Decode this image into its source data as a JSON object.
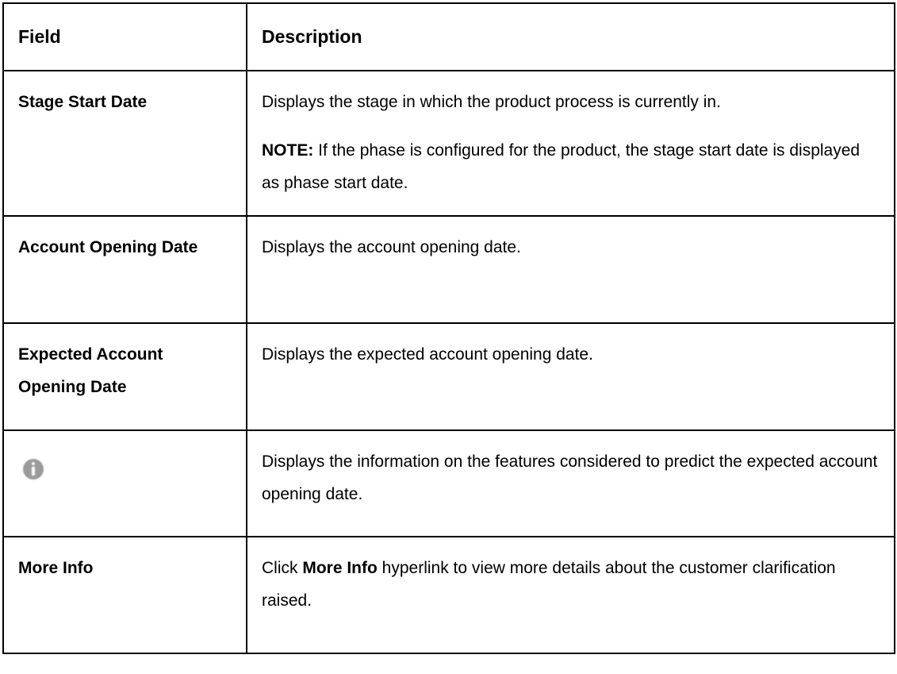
{
  "table": {
    "headers": {
      "field": "Field",
      "description": "Description"
    },
    "rows": [
      {
        "field": "Stage Start Date",
        "description": "Displays the stage in which the product process is currently in.",
        "note_label": "NOTE:",
        "note_text": " If the phase is configured for the product, the stage start date is displayed as phase start date."
      },
      {
        "field": "Account Opening Date",
        "description": "Displays the account opening date."
      },
      {
        "field": "Expected Account Opening Date",
        "description": "Displays the expected account opening date."
      },
      {
        "field_icon": "info-icon",
        "description": "Displays the information on the features considered to predict the expected account opening date."
      },
      {
        "field": "More Info",
        "description_pre": "Click ",
        "description_bold": "More Info",
        "description_post": " hyperlink to view more details about the customer clarification raised."
      }
    ]
  }
}
